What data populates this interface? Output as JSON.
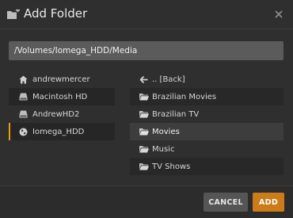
{
  "header": {
    "title": "Add Folder",
    "title_icon": "folder-plus-icon",
    "close_icon": "close-icon"
  },
  "path": {
    "value": "/Volumes/Iomega_HDD/Media"
  },
  "locations": [
    {
      "label": "andrewmercer",
      "icon": "home-icon"
    },
    {
      "label": "Macintosh HD",
      "icon": "hard-drive-icon"
    },
    {
      "label": "AndrewHD2",
      "icon": "hard-drive-icon"
    },
    {
      "label": "Iomega_HDD",
      "icon": "globe-icon",
      "selected": true
    }
  ],
  "folders": [
    {
      "label": ".. [Back]",
      "icon": "arrow-left-icon"
    },
    {
      "label": "Brazilian Movies",
      "icon": "folder-icon"
    },
    {
      "label": "Brazilian TV",
      "icon": "folder-icon"
    },
    {
      "label": "Movies",
      "icon": "folder-icon",
      "highlighted": true
    },
    {
      "label": "Music",
      "icon": "folder-icon"
    },
    {
      "label": "TV Shows",
      "icon": "folder-icon"
    }
  ],
  "buttons": {
    "cancel": "CANCEL",
    "add": "ADD"
  },
  "colors": {
    "accent": "#e5a00d",
    "add_button": "#cc7b19"
  }
}
